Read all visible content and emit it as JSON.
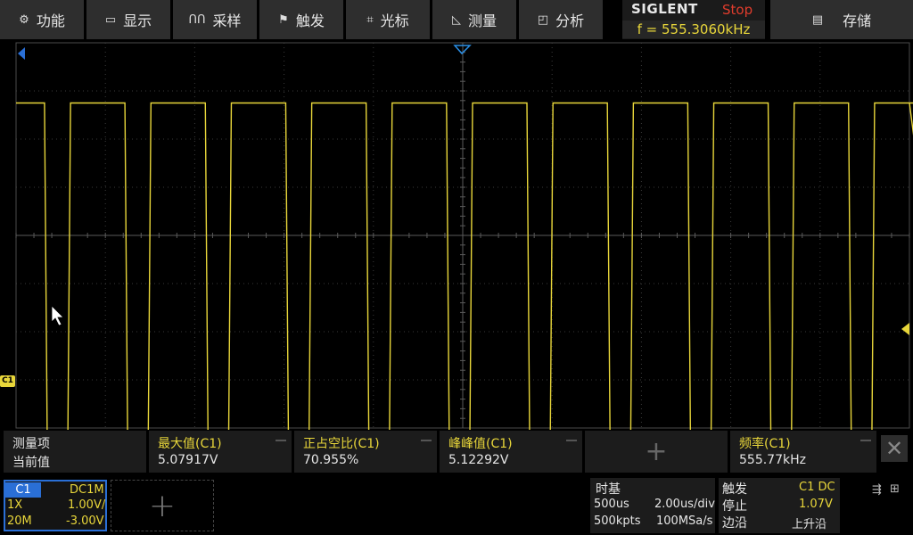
{
  "menu": [
    {
      "label": "功能",
      "icon": "gear-icon",
      "glyph": "⚙"
    },
    {
      "label": "显示",
      "icon": "display-icon",
      "glyph": "▭"
    },
    {
      "label": "采样",
      "icon": "sample-icon",
      "glyph": "ՈՈ"
    },
    {
      "label": "触发",
      "icon": "flag-icon",
      "glyph": "⚑"
    },
    {
      "label": "光标",
      "icon": "cursor-icon",
      "glyph": "⌗"
    },
    {
      "label": "测量",
      "icon": "ruler-icon",
      "glyph": "◺"
    },
    {
      "label": "分析",
      "icon": "analyze-icon",
      "glyph": "◰"
    }
  ],
  "brand": "SIGLENT",
  "run_state": "Stop",
  "frequency": "f = 555.3060kHz",
  "save": {
    "label": "存储",
    "icon": "save-icon",
    "glyph": "▤"
  },
  "colors": {
    "channel1": "#e8d63a",
    "stop": "#e03c2c",
    "accent": "#2a6fd6"
  },
  "markers": {
    "channel_label": "C1"
  },
  "waveform": {
    "period_divs": 0.9,
    "duty_percent": 70.955,
    "high_div": 2.75,
    "low_div": -4.15,
    "start_div": 0.58
  },
  "measurements": {
    "row_header": "测量项",
    "row_value": "当前值",
    "items": [
      {
        "name": "最大值(C1)",
        "value": "5.07917V"
      },
      {
        "name": "正占空比(C1)",
        "value": "70.955%"
      },
      {
        "name": "峰峰值(C1)",
        "value": "5.12292V"
      },
      {
        "name": "频率(C1)",
        "value": "555.77kHz"
      }
    ]
  },
  "channel": {
    "name": "C1",
    "coupling": "DC1M",
    "probe": "1X",
    "scale": "1.00V/",
    "bandwidth": "20M",
    "offset": "-3.00V"
  },
  "timebase": {
    "title": "时基",
    "delay": "500us",
    "scale": "2.00us/div",
    "memory": "500kpts",
    "sample_rate": "100MSa/s"
  },
  "trigger": {
    "title": "触发",
    "source": "C1 DC",
    "status": "停止",
    "level": "1.07V",
    "type": "边沿",
    "slope": "上升沿"
  }
}
